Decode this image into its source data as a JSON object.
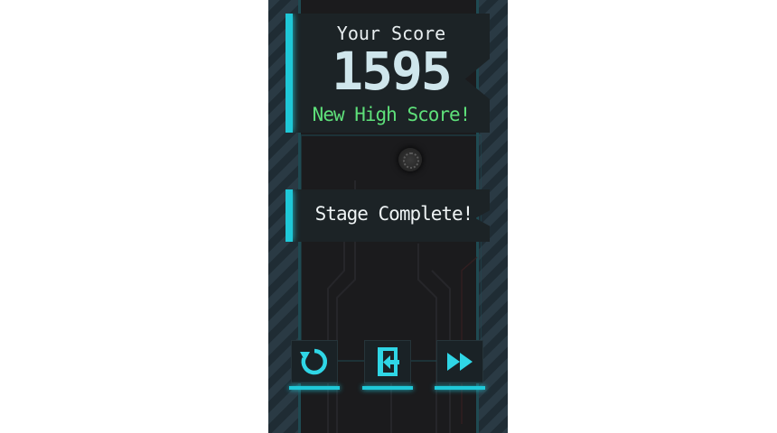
{
  "score_panel": {
    "label": "Your Score",
    "score": "1595",
    "high_score_text": "New High Score!"
  },
  "stage_panel": {
    "text": "Stage Complete!"
  },
  "buttons": {
    "restart_icon": "restart-icon",
    "exit_icon": "exit-icon",
    "next_icon": "fast-forward-icon"
  },
  "colors": {
    "accent": "#1fc8d8",
    "high_score": "#5ee07a",
    "panel": "#1c2326"
  }
}
